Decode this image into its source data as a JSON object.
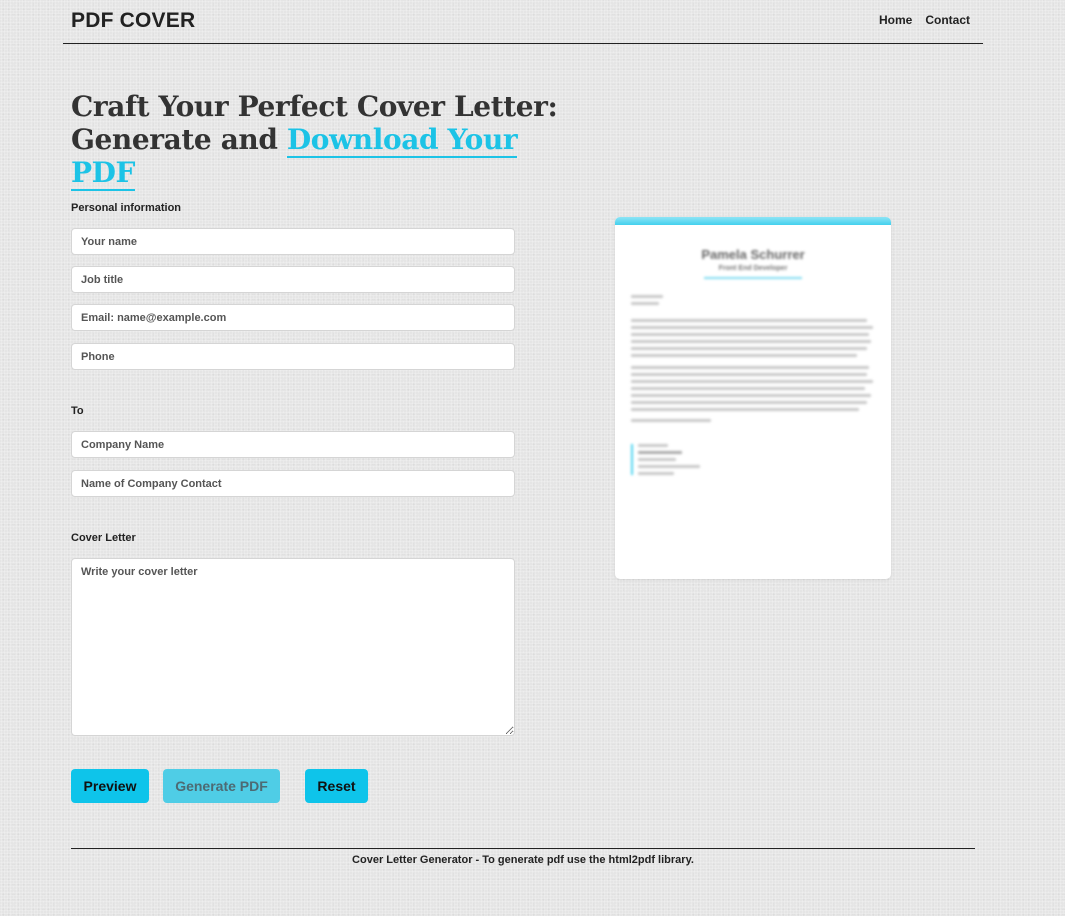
{
  "nav": {
    "brand": "PDF COVER",
    "links": [
      "Home",
      "Contact"
    ]
  },
  "hero": {
    "line1": "Craft Your Perfect Cover Letter:",
    "line2_prefix": "Generate and ",
    "line2_accent": "Download Your PDF"
  },
  "form": {
    "personal_label": "Personal information",
    "name_placeholder": "Your name",
    "job_placeholder": "Job title",
    "email_placeholder": "Email: name@example.com",
    "phone_placeholder": "Phone",
    "to_label": "To",
    "company_placeholder": "Company Name",
    "contact_placeholder": "Name of Company Contact",
    "cover_label": "Cover Letter",
    "cover_placeholder": "Write your cover letter"
  },
  "buttons": {
    "preview": "Preview",
    "generate": "Generate PDF",
    "reset": "Reset"
  },
  "preview": {
    "name": "Pamela Schurrer",
    "title": "Front End Developer"
  },
  "footer": {
    "text": "Cover Letter Generator - To generate pdf use the html2pdf library."
  },
  "colors": {
    "accent": "#1cc3e6",
    "button": "#0ec4ea",
    "background": "#e5e5e5"
  }
}
